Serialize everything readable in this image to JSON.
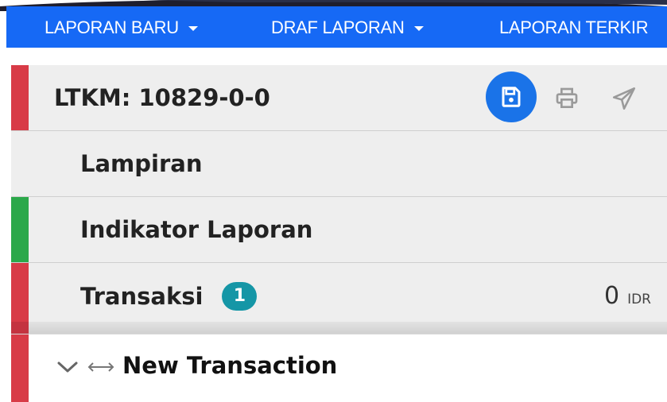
{
  "nav": {
    "items": [
      {
        "label": "LAPORAN BARU",
        "has_dropdown": true
      },
      {
        "label": "DRAF LAPORAN",
        "has_dropdown": true
      },
      {
        "label": "LAPORAN TERKIR",
        "has_dropdown": false
      }
    ],
    "bg_color": "#1669f5"
  },
  "report": {
    "title": "LTKM: 10829-0-0",
    "status_color": "#d83b47",
    "actions": [
      {
        "name": "save",
        "icon": "floppy-disk-icon"
      },
      {
        "name": "print",
        "icon": "printer-icon"
      },
      {
        "name": "send",
        "icon": "paper-plane-icon"
      }
    ]
  },
  "sections": [
    {
      "label": "Lampiran",
      "status_color": ""
    },
    {
      "label": "Indikator Laporan",
      "status_color": "#2ba84a"
    },
    {
      "label": "Transaksi",
      "status_color": "#d83b47",
      "badge": "1",
      "amount": "0",
      "currency": "IDR"
    }
  ],
  "transaction": {
    "label": "New Transaction",
    "status_color": "#d83b47"
  }
}
